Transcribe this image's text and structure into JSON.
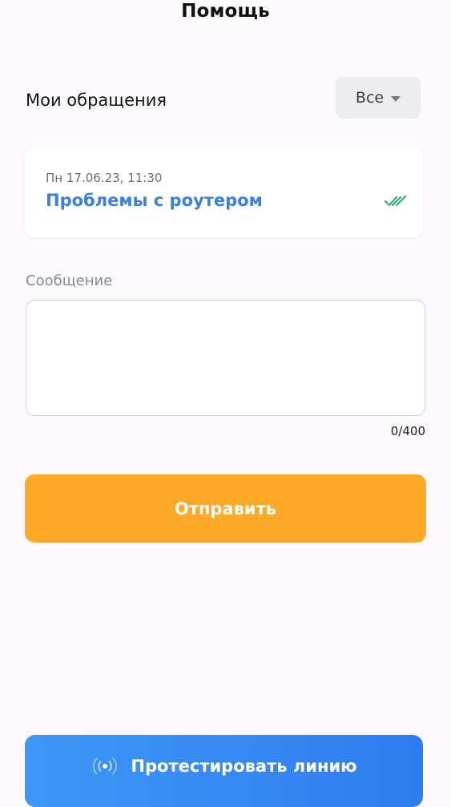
{
  "header": {
    "title": "Помощь"
  },
  "tickets_section": {
    "title": "Мои обращения",
    "filter": {
      "selected": "Все",
      "icon": "chevron-down-icon"
    },
    "items": [
      {
        "date": "Пн 17.06.23, 11:30",
        "subject": "Проблемы с роутером",
        "status_icon": "double-check-icon",
        "status_color": "#2fb36b"
      }
    ]
  },
  "message_form": {
    "label": "Сообщение",
    "value": "",
    "counter": "0/400",
    "send_label": "Отправить"
  },
  "footer": {
    "test_line_label": "Протестировать линию",
    "test_line_icon": "broadcast-icon"
  },
  "colors": {
    "accent_orange": "#fca927",
    "accent_blue": "#3a80e0",
    "button_blue": "#2f7cf0",
    "background": "#fbf9fc"
  }
}
